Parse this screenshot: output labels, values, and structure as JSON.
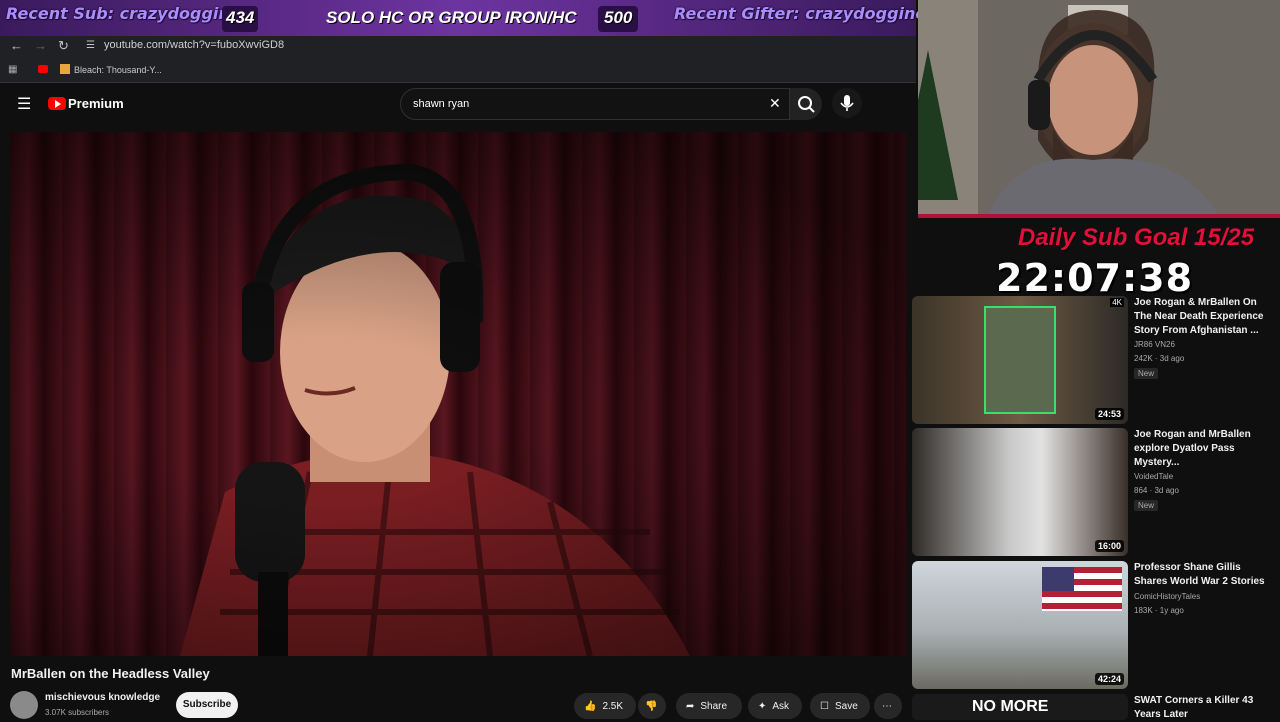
{
  "overlay": {
    "recent_sub": "Recent Sub: crazydogginoc",
    "count_left": "434",
    "goal_text": "SOLO HC OR GROUP IRON/HC",
    "count_right": "500",
    "recent_gifter": "Recent Gifter: crazydogginoc",
    "daily_sub_goal": "Daily Sub Goal 15/25",
    "clock": "22:07:38"
  },
  "browser": {
    "url": "youtube.com/watch?v=fuboXwviGD8",
    "bookmark": "Bleach: Thousand-Y..."
  },
  "youtube": {
    "logo_text": "Premium",
    "search_value": "shawn ryan"
  },
  "video": {
    "title": "MrBallen on the Headless Valley",
    "channel": "mischievous knowledge",
    "subscribers": "3.07K subscribers",
    "subscribe_label": "Subscribe",
    "likes": "2.5K",
    "share_label": "Share",
    "ask_label": "Ask",
    "save_label": "Save"
  },
  "related": [
    {
      "title": "Joe Rogan & MrBallen On The Near Death Experience Story From Afghanistan ...",
      "channel": "JR86 VN26",
      "meta": "242K · 3d ago",
      "badge": "New",
      "duration": "24:53",
      "quality": "4K"
    },
    {
      "title": "Joe Rogan and MrBallen explore Dyatlov Pass Mystery...",
      "channel": "VoidedTale",
      "meta": "864 · 3d ago",
      "badge": "New",
      "duration": "16:00"
    },
    {
      "title": "Professor Shane Gillis Shares World War 2 Stories",
      "channel": "ComicHistoryTales",
      "meta": "183K · 1y ago",
      "duration": "42:24"
    },
    {
      "title": "SWAT Corners a Killer 43 Years Later",
      "thumb_text": "NO MORE"
    }
  ],
  "colors": {
    "accent": "#ff0000",
    "overlay_purple": "#6d34a0",
    "goal_red": "#e0103a"
  }
}
